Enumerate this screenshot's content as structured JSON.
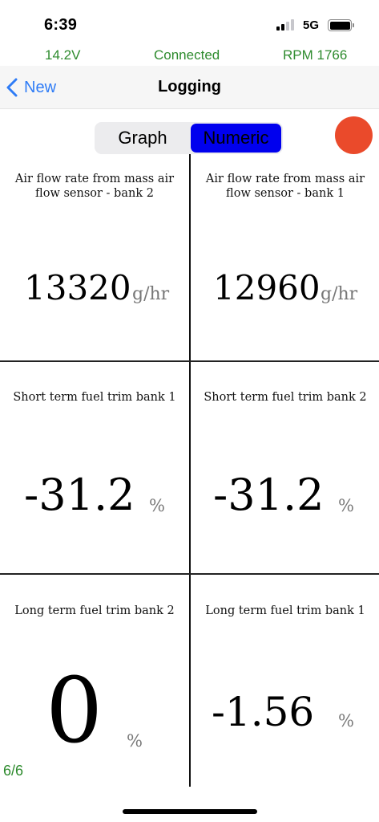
{
  "status_bar": {
    "time": "6:39",
    "network": "5G",
    "signal_bars_filled": 2,
    "signal_bars_total": 4,
    "battery_level": 1.0
  },
  "info": {
    "voltage": "14.2V",
    "connection": "Connected",
    "rpm": "RPM 1766"
  },
  "nav": {
    "back_label": "New",
    "title": "Logging"
  },
  "segment": {
    "graph_label": "Graph",
    "numeric_label": "Numeric",
    "selected": "Numeric"
  },
  "colors": {
    "accent_green": "#2e8b2e",
    "back_blue": "#2f7cf6",
    "segment_selected": "#0000ee",
    "record_red": "#ea4a2b"
  },
  "cells": [
    {
      "label": "Air flow rate from mass air flow sensor - bank 2",
      "value": "13320",
      "unit": "g/hr"
    },
    {
      "label": "Air flow rate from mass air flow sensor - bank 1",
      "value": "12960",
      "unit": "g/hr"
    },
    {
      "label": "Short term fuel trim bank 1",
      "value": "-31.2",
      "unit": "%"
    },
    {
      "label": "Short term fuel trim bank 2",
      "value": "-31.2",
      "unit": "%"
    },
    {
      "label": "Long term fuel trim bank 2",
      "value": "0",
      "unit": "%"
    },
    {
      "label": "Long term fuel trim bank 1",
      "value": "-1.56",
      "unit": "%"
    }
  ],
  "page_counter": "6/6"
}
